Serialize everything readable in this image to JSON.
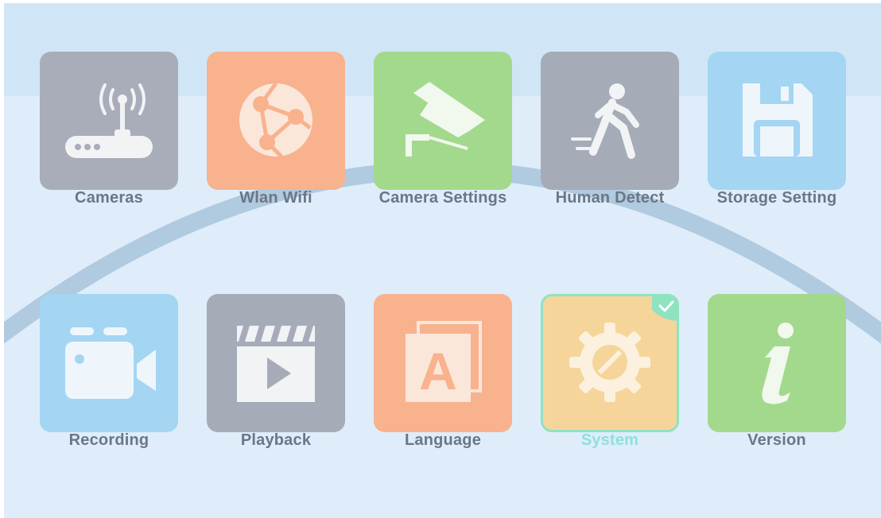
{
  "menu": {
    "items": [
      {
        "label": "Cameras",
        "icon": "router-antenna-icon",
        "color": "#a9adb9"
      },
      {
        "label": "Wlan Wifi",
        "icon": "network-globe-icon",
        "color": "#f8b28e"
      },
      {
        "label": "Camera Settings",
        "icon": "security-camera-icon",
        "color": "#a3d98d"
      },
      {
        "label": "Human Detect",
        "icon": "running-person-icon",
        "color": "#a6abb8"
      },
      {
        "label": "Storage Setting",
        "icon": "floppy-disk-icon",
        "color": "#a4d5f3"
      },
      {
        "label": "Recording",
        "icon": "video-camera-icon",
        "color": "#a4d5f3"
      },
      {
        "label": "Playback",
        "icon": "clapperboard-play-icon",
        "color": "#a6abb8"
      },
      {
        "label": "Language",
        "icon": "language-letter-icon",
        "color": "#f8b28e"
      },
      {
        "label": "System",
        "icon": "gear-icon",
        "color": "#f6d59b",
        "selected": true
      },
      {
        "label": "Version",
        "icon": "info-icon",
        "color": "#a3d98d"
      }
    ],
    "selected_index": 8,
    "accent": "#8fe3c0"
  }
}
